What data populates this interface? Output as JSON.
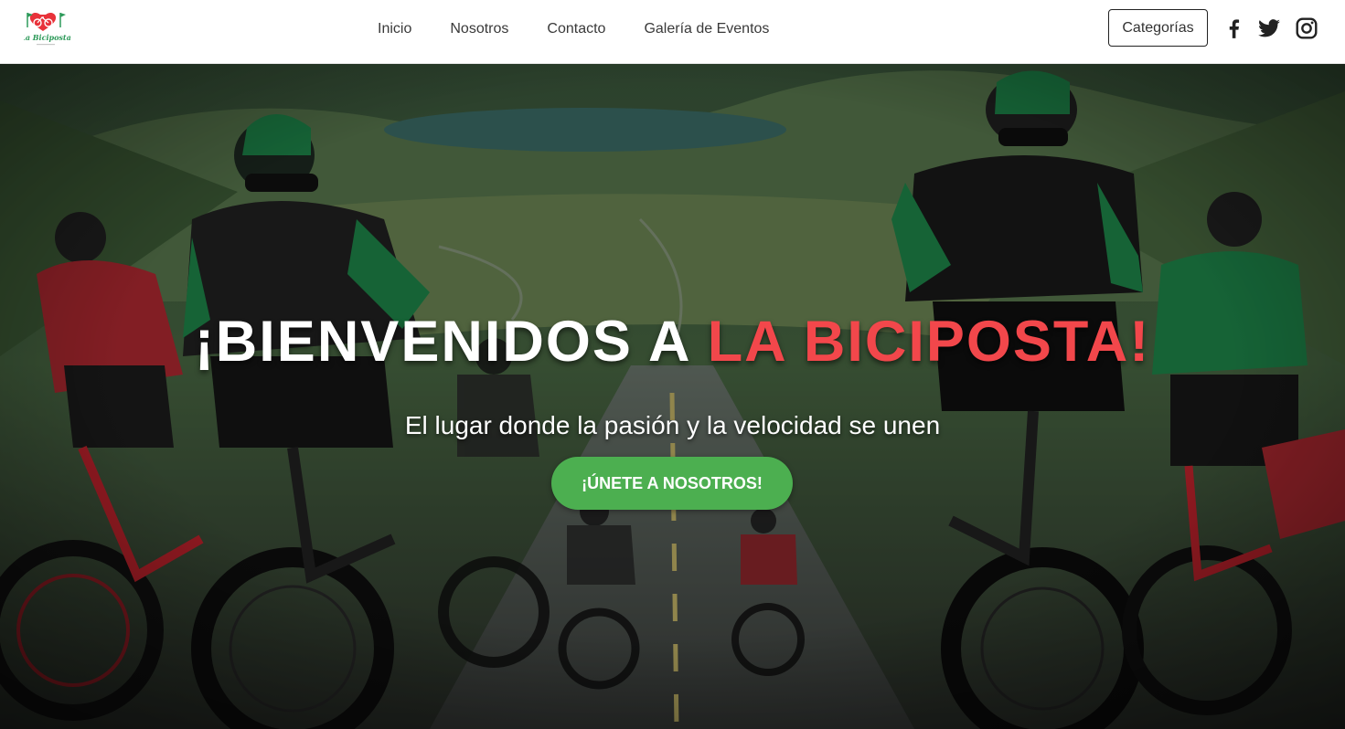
{
  "brand": {
    "logo_text": "La Biciposta",
    "logo_icon": "bicycle-logo-icon",
    "logo_color": "#e8323a"
  },
  "nav": {
    "links": [
      {
        "label": "Inicio"
      },
      {
        "label": "Nosotros"
      },
      {
        "label": "Contacto"
      },
      {
        "label": "Galería de Eventos"
      }
    ],
    "categories_button": "Categorías",
    "social": [
      {
        "name": "facebook-icon"
      },
      {
        "name": "twitter-icon"
      },
      {
        "name": "instagram-icon"
      }
    ]
  },
  "hero": {
    "title_prefix": "¡BIENVENIDOS A ",
    "title_highlight": "LA BICIPOSTA!",
    "subtitle": "El lugar donde la pasión y la velocidad se unen",
    "cta_label": "¡ÚNETE A NOSOTROS!",
    "background_image": "cyclists-racing-mountain-road-photo"
  },
  "colors": {
    "accent": "#f2474b",
    "cta": "#4caf50",
    "nav_text": "#3a3a3a",
    "jersey_green": "#1f8a4c",
    "jersey_red": "#c8242e"
  }
}
